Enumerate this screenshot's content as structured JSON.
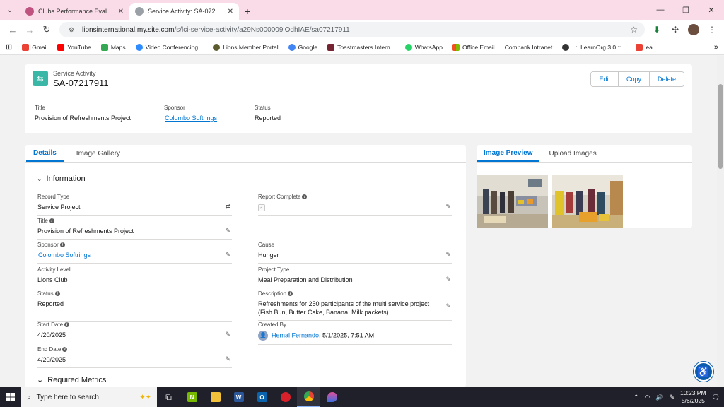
{
  "browser": {
    "tabs": [
      {
        "title": "Clubs Performance Evaluation S",
        "active": false
      },
      {
        "title": "Service Activity: SA-07217911",
        "active": true
      }
    ],
    "url_domain": "lionsinternational.my.site.com",
    "url_path": "/s/lci-service-activity/a29Ns000009jOdhIAE/sa07217911",
    "bookmarks": [
      "Gmail",
      "YouTube",
      "Maps",
      "Video Conferencing...",
      "Lions Member Portal",
      "Google",
      "Toastmasters Intern...",
      "WhatsApp",
      "Office Email",
      "Combank Intranet",
      "..:: LearnOrg 3.0 ::...",
      "ea"
    ]
  },
  "record": {
    "type_label": "Service Activity",
    "name": "SA-07217911",
    "actions": {
      "edit": "Edit",
      "copy": "Copy",
      "delete": "Delete"
    },
    "highlights": {
      "title_label": "Title",
      "title_value": "Provision of Refreshments Project",
      "sponsor_label": "Sponsor",
      "sponsor_value": "Colombo Softrings",
      "status_label": "Status",
      "status_value": "Reported"
    }
  },
  "details": {
    "tabs": {
      "details": "Details",
      "gallery": "Image Gallery"
    },
    "section_information": "Information",
    "section_metrics": "Required Metrics",
    "fields": {
      "record_type": {
        "label": "Record Type",
        "value": "Service Project"
      },
      "report_complete": {
        "label": "Report Complete"
      },
      "title": {
        "label": "Title",
        "value": "Provision of Refreshments Project"
      },
      "sponsor": {
        "label": "Sponsor",
        "value": "Colombo Softrings"
      },
      "cause": {
        "label": "Cause",
        "value": "Hunger"
      },
      "activity_level": {
        "label": "Activity Level",
        "value": "Lions Club"
      },
      "project_type": {
        "label": "Project Type",
        "value": "Meal Preparation and Distribution"
      },
      "status": {
        "label": "Status",
        "value": "Reported"
      },
      "description": {
        "label": "Description",
        "value": "Refreshments for 250 participants of the multi service project (Fish Bun, Butter Cake, Banana, Milk packets)"
      },
      "start_date": {
        "label": "Start Date",
        "value": "4/20/2025"
      },
      "created_by": {
        "label": "Created By",
        "user": "Hemal Fernando",
        "when": ", 5/1/2025, 7:51 AM"
      },
      "end_date": {
        "label": "End Date",
        "value": "4/20/2025"
      }
    }
  },
  "preview": {
    "tabs": {
      "preview": "Image Preview",
      "upload": "Upload Images"
    }
  },
  "taskbar": {
    "search_placeholder": "Type here to search",
    "time": "10:23 PM",
    "date": "5/6/2025"
  }
}
